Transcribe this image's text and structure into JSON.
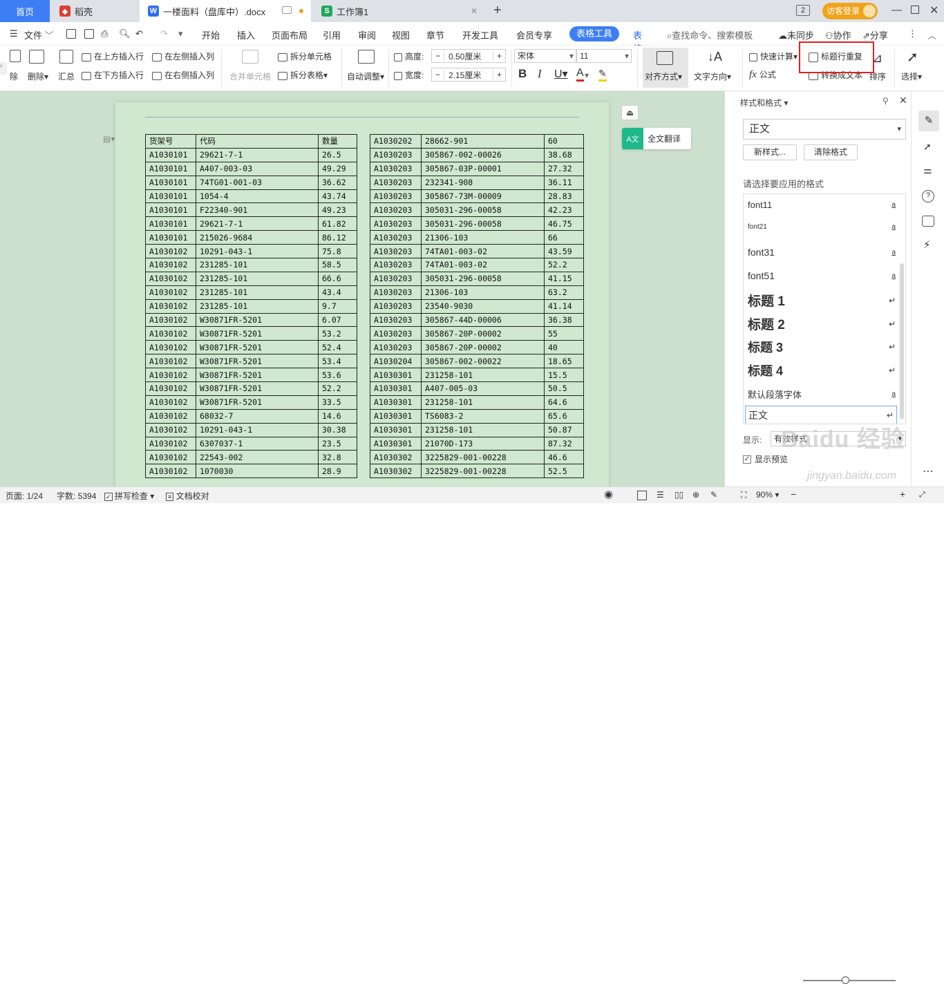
{
  "tabs": {
    "home": "首页",
    "daoke": "稻壳",
    "doc": "一楼面料（盘库中）.docx",
    "xls": "工作簿1",
    "login": "访客登录",
    "badge": "2"
  },
  "menu": {
    "file": "文件",
    "items": [
      "开始",
      "插入",
      "页面布局",
      "引用",
      "审阅",
      "视图",
      "章节",
      "开发工具",
      "会员专享"
    ],
    "active_tab": "表格工具",
    "cut_tab": "表格",
    "search": "查找命令、搜索模板",
    "sync": "未同步",
    "collab": "协作",
    "share": "分享"
  },
  "ribbon": {
    "delete_cut": "除",
    "delete": "删除",
    "summary": "汇总",
    "insert_above": "在上方插入行",
    "insert_below": "在下方插入行",
    "insert_left": "在左侧插入列",
    "insert_right": "在右侧插入列",
    "merge": "合并单元格",
    "split_cell": "拆分单元格",
    "split_table": "拆分表格",
    "auto_adjust": "自动调整",
    "height_label": "高度:",
    "height_value": "0.50厘米",
    "width_label": "宽度:",
    "width_value": "2.15厘米",
    "font_name": "宋体",
    "font_size": "11",
    "align": "对齐方式",
    "text_dir": "文字方向",
    "quick_calc": "快速计算",
    "formula": "公式",
    "header_repeat": "标题行重复",
    "to_text": "转换成文本",
    "sort": "排序",
    "select": "选择",
    "highlight_color": "#e02020"
  },
  "floating": {
    "translate": "全文翻译"
  },
  "table_left": {
    "header": [
      "货架号",
      "代码",
      "数量"
    ],
    "rows": [
      [
        "A1030101",
        "29621-7-1",
        "26.5"
      ],
      [
        "A1030101",
        "A407-003-03",
        "49.29"
      ],
      [
        "A1030101",
        "74TG01-001-03",
        "36.62"
      ],
      [
        "A1030101",
        "1054-4",
        "43.74"
      ],
      [
        "A1030101",
        "F22340-901",
        "49.23"
      ],
      [
        "A1030101",
        "29621-7-1",
        "61.82"
      ],
      [
        "A1030101",
        "215026-9684",
        "86.12"
      ],
      [
        "A1030102",
        "10291-043-1",
        "75.8"
      ],
      [
        "A1030102",
        "231285-101",
        "58.5"
      ],
      [
        "A1030102",
        "231285-101",
        "66.6"
      ],
      [
        "A1030102",
        "231285-101",
        "43.4"
      ],
      [
        "A1030102",
        "231285-101",
        "9.7"
      ],
      [
        "A1030102",
        "W30871FR-5201",
        "6.07"
      ],
      [
        "A1030102",
        "W30871FR-5201",
        "53.2"
      ],
      [
        "A1030102",
        "W30871FR-5201",
        "52.4"
      ],
      [
        "A1030102",
        "W30871FR-5201",
        "53.4"
      ],
      [
        "A1030102",
        "W30871FR-5201",
        "53.6"
      ],
      [
        "A1030102",
        "W30871FR-5201",
        "52.2"
      ],
      [
        "A1030102",
        "W30871FR-5201",
        "33.5"
      ],
      [
        "A1030102",
        "68032-7",
        "14.6"
      ],
      [
        "A1030102",
        "10291-043-1",
        "30.38"
      ],
      [
        "A1030102",
        "6307037-1",
        "23.5"
      ],
      [
        "A1030102",
        "22543-002",
        "32.8"
      ],
      [
        "A1030102",
        "1070030",
        "28.9"
      ]
    ]
  },
  "table_right": {
    "rows": [
      [
        "A1030202",
        "28662-901",
        "60"
      ],
      [
        "A1030203",
        "305867-002-00026",
        "38.68"
      ],
      [
        "A1030203",
        "305867-03P-00001",
        "27.32"
      ],
      [
        "A1030203",
        "232341-908",
        "36.11"
      ],
      [
        "A1030203",
        "305867-73M-00009",
        "28.83"
      ],
      [
        "A1030203",
        "305031-296-00058",
        "42.23"
      ],
      [
        "A1030203",
        "305031-296-00058",
        "46.75"
      ],
      [
        "A1030203",
        "21306-103",
        "66"
      ],
      [
        "A1030203",
        "74TA01-003-02",
        "43.59"
      ],
      [
        "A1030203",
        "74TA01-003-02",
        "52.2"
      ],
      [
        "A1030203",
        "305031-296-00058",
        "41.15"
      ],
      [
        "A1030203",
        "21306-103",
        "63.2"
      ],
      [
        "A1030203",
        "23540-9030",
        "41.14"
      ],
      [
        "A1030203",
        "305867-44D-00006",
        "36.38"
      ],
      [
        "A1030203",
        "305867-20P-00002",
        "55"
      ],
      [
        "A1030203",
        "305867-20P-00002",
        "40"
      ],
      [
        "A1030204",
        "305867-002-00022",
        "18.65"
      ],
      [
        "A1030301",
        "231258-101",
        "15.5"
      ],
      [
        "A1030301",
        "A407-005-03",
        "50.5"
      ],
      [
        "A1030301",
        "231258-101",
        "64.6"
      ],
      [
        "A1030301",
        "TS6083-2",
        "65.6"
      ],
      [
        "A1030301",
        "231258-101",
        "50.87"
      ],
      [
        "A1030301",
        "21070D-173",
        "87.32"
      ],
      [
        "A1030302",
        "3225829-001-00228",
        "46.6"
      ],
      [
        "A1030302",
        "3225829-001-00228",
        "52.5"
      ]
    ]
  },
  "panel": {
    "title": "样式和格式",
    "current_style": "正文",
    "new_style": "新样式...",
    "clear_format": "清除格式",
    "prompt": "请选择要应用的格式",
    "styles": [
      {
        "name": "font11",
        "mark": "a"
      },
      {
        "name": "font21",
        "mark": "a"
      },
      {
        "name": "font31",
        "mark": "a"
      },
      {
        "name": "font51",
        "mark": "a"
      },
      {
        "name": "标题 1",
        "mark": "↵"
      },
      {
        "name": "标题 2",
        "mark": "↵"
      },
      {
        "name": "标题 3",
        "mark": "↵"
      },
      {
        "name": "标题 4",
        "mark": "↵"
      },
      {
        "name": "默认段落字体",
        "mark": "a"
      },
      {
        "name": "正文",
        "mark": "↵"
      }
    ],
    "show_label": "显示:",
    "show_value": "有效样式",
    "preview": "显示预览"
  },
  "status": {
    "page": "页面: 1/24",
    "words": "字数: 5394",
    "spell": "拼写检查",
    "proof": "文档校对",
    "zoom": "90%"
  },
  "watermark": {
    "text1": "Baidu 经验",
    "text2": "jingyan.baidu.com"
  }
}
